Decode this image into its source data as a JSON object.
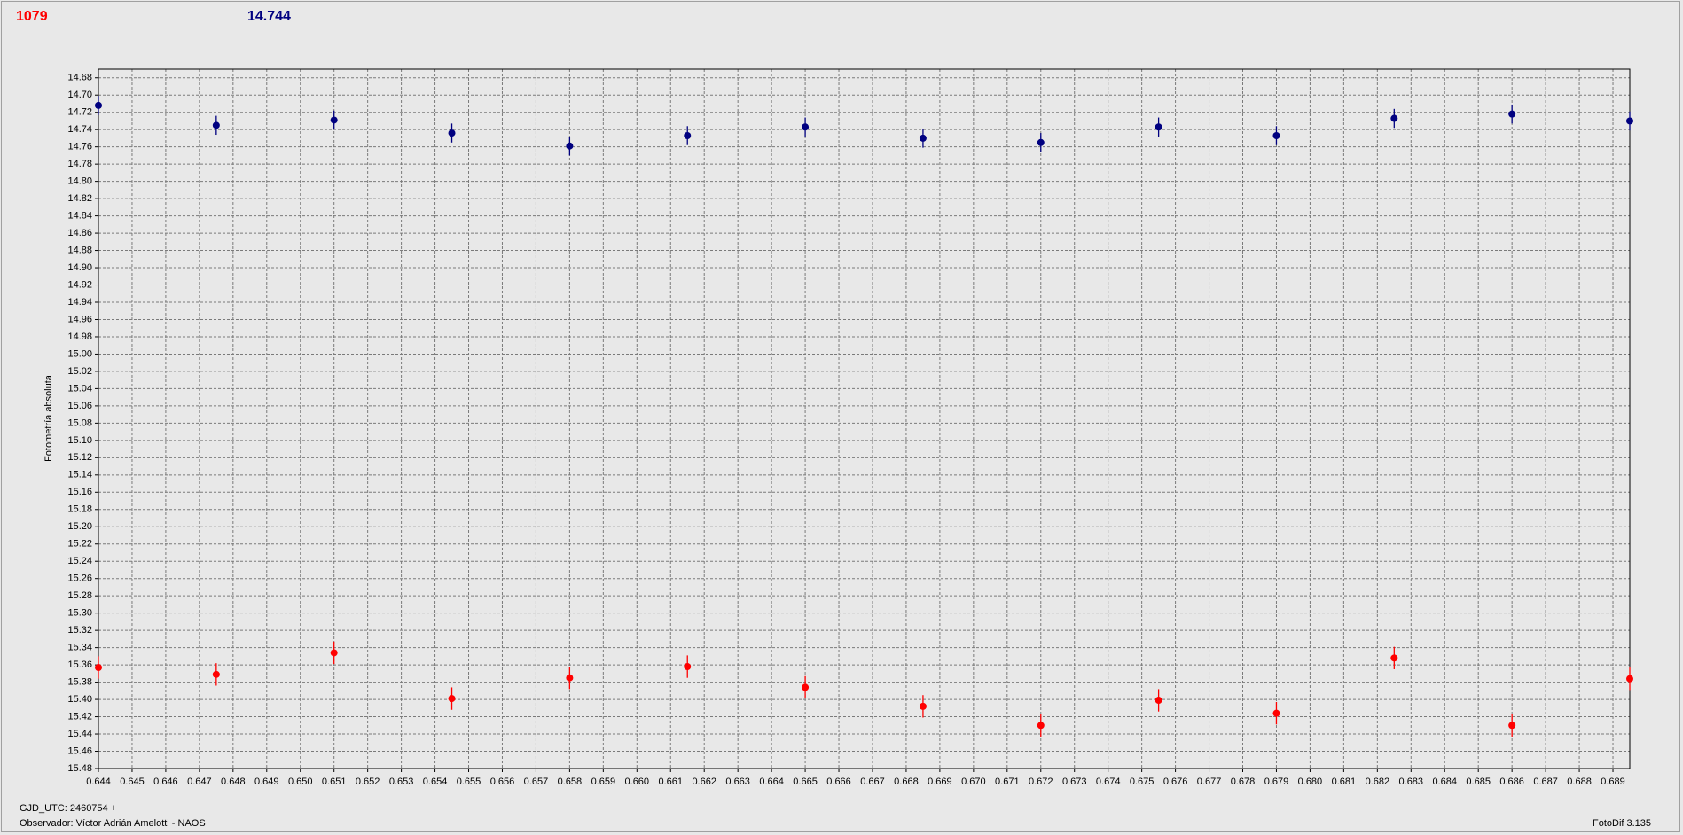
{
  "header": {
    "left_value": "1079",
    "right_value": "14.744"
  },
  "footer": {
    "gjd": "GJD_UTC: 2460754 +",
    "observer": "Observador: Víctor Adrián Amelotti - NAOS",
    "software": "FotoDif 3.135"
  },
  "colors": {
    "series_red": "#ff0000",
    "series_blue": "#000080",
    "grid": "#7a7a7a",
    "plot_bg": "#e8e8e8"
  },
  "chart_data": {
    "type": "scatter",
    "title": "",
    "xlabel": "",
    "ylabel": "Fotometría absoluta",
    "xlim": [
      0.644,
      0.6895
    ],
    "ylim": [
      15.48,
      14.67
    ],
    "y_inverted": true,
    "grid": true,
    "x_ticks": [
      "0.644",
      "0.645",
      "0.646",
      "0.647",
      "0.648",
      "0.649",
      "0.650",
      "0.651",
      "0.652",
      "0.653",
      "0.654",
      "0.655",
      "0.656",
      "0.657",
      "0.658",
      "0.659",
      "0.660",
      "0.661",
      "0.662",
      "0.663",
      "0.664",
      "0.665",
      "0.666",
      "0.667",
      "0.668",
      "0.669",
      "0.670",
      "0.671",
      "0.672",
      "0.673",
      "0.674",
      "0.675",
      "0.676",
      "0.677",
      "0.678",
      "0.679",
      "0.680",
      "0.681",
      "0.682",
      "0.683",
      "0.684",
      "0.685",
      "0.686",
      "0.687",
      "0.688",
      "0.689"
    ],
    "y_ticks": [
      "14.68",
      "14.70",
      "14.72",
      "14.74",
      "14.76",
      "14.78",
      "14.80",
      "14.82",
      "14.84",
      "14.86",
      "14.88",
      "14.90",
      "14.92",
      "14.94",
      "14.96",
      "14.98",
      "15.00",
      "15.02",
      "15.04",
      "15.06",
      "15.08",
      "15.10",
      "15.12",
      "15.14",
      "15.16",
      "15.18",
      "15.20",
      "15.22",
      "15.24",
      "15.26",
      "15.28",
      "15.30",
      "15.32",
      "15.34",
      "15.36",
      "15.38",
      "15.40",
      "15.42",
      "15.44",
      "15.46",
      "15.48"
    ],
    "series": [
      {
        "color": "#000080",
        "error": 0.011,
        "x": [
          0.644,
          0.6475,
          0.651,
          0.6545,
          0.658,
          0.6615,
          0.665,
          0.6685,
          0.672,
          0.6755,
          0.679,
          0.6825,
          0.686,
          0.6895
        ],
        "y": [
          14.712,
          14.735,
          14.729,
          14.744,
          14.759,
          14.747,
          14.737,
          14.75,
          14.755,
          14.737,
          14.747,
          14.727,
          14.722,
          14.73
        ]
      },
      {
        "color": "#ff0000",
        "error": 0.013,
        "x": [
          0.644,
          0.6475,
          0.651,
          0.6545,
          0.658,
          0.6615,
          0.665,
          0.6685,
          0.672,
          0.6755,
          0.679,
          0.6825,
          0.686,
          0.6895
        ],
        "y": [
          15.363,
          15.371,
          15.346,
          15.399,
          15.375,
          15.362,
          15.386,
          15.408,
          15.43,
          15.401,
          15.416,
          15.352,
          15.43,
          15.376
        ]
      }
    ]
  }
}
